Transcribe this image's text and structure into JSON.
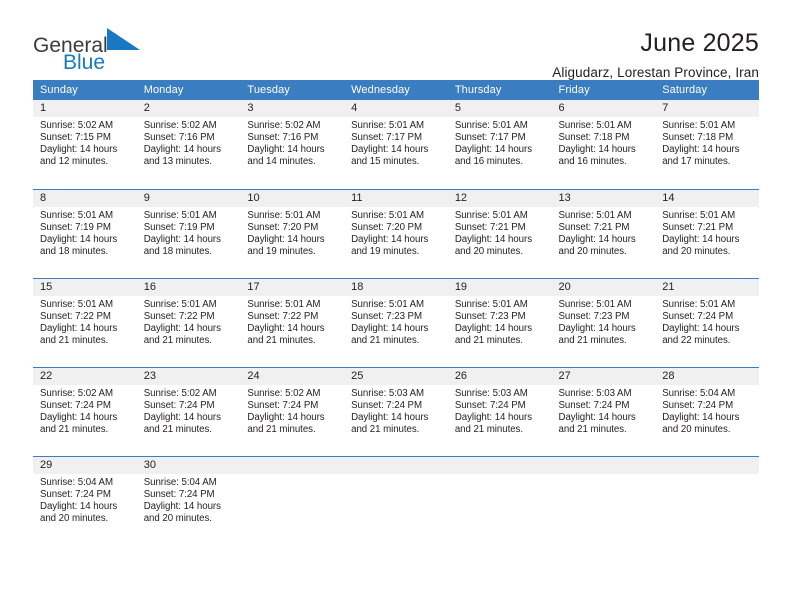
{
  "brand": {
    "word1": "General",
    "word2": "Blue",
    "triangle_color": "#1878c4",
    "word1_color": "#3c3c3c",
    "word2_color": "#1878c4"
  },
  "header": {
    "title": "June 2025",
    "subtitle": "Aligudarz, Lorestan Province, Iran"
  },
  "theme": {
    "header_bg": "#3a7dc0",
    "header_text": "#ffffff",
    "daynum_bg": "#f0f0f0",
    "row_divider": "#3a7dc0",
    "body_text": "#231f20"
  },
  "calendar": {
    "weekday_headers": [
      "Sunday",
      "Monday",
      "Tuesday",
      "Wednesday",
      "Thursday",
      "Friday",
      "Saturday"
    ],
    "weeks": [
      [
        {
          "day": "1",
          "lines": [
            "Sunrise: 5:02 AM",
            "Sunset: 7:15 PM",
            "Daylight: 14 hours",
            "and 12 minutes."
          ]
        },
        {
          "day": "2",
          "lines": [
            "Sunrise: 5:02 AM",
            "Sunset: 7:16 PM",
            "Daylight: 14 hours",
            "and 13 minutes."
          ]
        },
        {
          "day": "3",
          "lines": [
            "Sunrise: 5:02 AM",
            "Sunset: 7:16 PM",
            "Daylight: 14 hours",
            "and 14 minutes."
          ]
        },
        {
          "day": "4",
          "lines": [
            "Sunrise: 5:01 AM",
            "Sunset: 7:17 PM",
            "Daylight: 14 hours",
            "and 15 minutes."
          ]
        },
        {
          "day": "5",
          "lines": [
            "Sunrise: 5:01 AM",
            "Sunset: 7:17 PM",
            "Daylight: 14 hours",
            "and 16 minutes."
          ]
        },
        {
          "day": "6",
          "lines": [
            "Sunrise: 5:01 AM",
            "Sunset: 7:18 PM",
            "Daylight: 14 hours",
            "and 16 minutes."
          ]
        },
        {
          "day": "7",
          "lines": [
            "Sunrise: 5:01 AM",
            "Sunset: 7:18 PM",
            "Daylight: 14 hours",
            "and 17 minutes."
          ]
        }
      ],
      [
        {
          "day": "8",
          "lines": [
            "Sunrise: 5:01 AM",
            "Sunset: 7:19 PM",
            "Daylight: 14 hours",
            "and 18 minutes."
          ]
        },
        {
          "day": "9",
          "lines": [
            "Sunrise: 5:01 AM",
            "Sunset: 7:19 PM",
            "Daylight: 14 hours",
            "and 18 minutes."
          ]
        },
        {
          "day": "10",
          "lines": [
            "Sunrise: 5:01 AM",
            "Sunset: 7:20 PM",
            "Daylight: 14 hours",
            "and 19 minutes."
          ]
        },
        {
          "day": "11",
          "lines": [
            "Sunrise: 5:01 AM",
            "Sunset: 7:20 PM",
            "Daylight: 14 hours",
            "and 19 minutes."
          ]
        },
        {
          "day": "12",
          "lines": [
            "Sunrise: 5:01 AM",
            "Sunset: 7:21 PM",
            "Daylight: 14 hours",
            "and 20 minutes."
          ]
        },
        {
          "day": "13",
          "lines": [
            "Sunrise: 5:01 AM",
            "Sunset: 7:21 PM",
            "Daylight: 14 hours",
            "and 20 minutes."
          ]
        },
        {
          "day": "14",
          "lines": [
            "Sunrise: 5:01 AM",
            "Sunset: 7:21 PM",
            "Daylight: 14 hours",
            "and 20 minutes."
          ]
        }
      ],
      [
        {
          "day": "15",
          "lines": [
            "Sunrise: 5:01 AM",
            "Sunset: 7:22 PM",
            "Daylight: 14 hours",
            "and 21 minutes."
          ]
        },
        {
          "day": "16",
          "lines": [
            "Sunrise: 5:01 AM",
            "Sunset: 7:22 PM",
            "Daylight: 14 hours",
            "and 21 minutes."
          ]
        },
        {
          "day": "17",
          "lines": [
            "Sunrise: 5:01 AM",
            "Sunset: 7:22 PM",
            "Daylight: 14 hours",
            "and 21 minutes."
          ]
        },
        {
          "day": "18",
          "lines": [
            "Sunrise: 5:01 AM",
            "Sunset: 7:23 PM",
            "Daylight: 14 hours",
            "and 21 minutes."
          ]
        },
        {
          "day": "19",
          "lines": [
            "Sunrise: 5:01 AM",
            "Sunset: 7:23 PM",
            "Daylight: 14 hours",
            "and 21 minutes."
          ]
        },
        {
          "day": "20",
          "lines": [
            "Sunrise: 5:01 AM",
            "Sunset: 7:23 PM",
            "Daylight: 14 hours",
            "and 21 minutes."
          ]
        },
        {
          "day": "21",
          "lines": [
            "Sunrise: 5:01 AM",
            "Sunset: 7:24 PM",
            "Daylight: 14 hours",
            "and 22 minutes."
          ]
        }
      ],
      [
        {
          "day": "22",
          "lines": [
            "Sunrise: 5:02 AM",
            "Sunset: 7:24 PM",
            "Daylight: 14 hours",
            "and 21 minutes."
          ]
        },
        {
          "day": "23",
          "lines": [
            "Sunrise: 5:02 AM",
            "Sunset: 7:24 PM",
            "Daylight: 14 hours",
            "and 21 minutes."
          ]
        },
        {
          "day": "24",
          "lines": [
            "Sunrise: 5:02 AM",
            "Sunset: 7:24 PM",
            "Daylight: 14 hours",
            "and 21 minutes."
          ]
        },
        {
          "day": "25",
          "lines": [
            "Sunrise: 5:03 AM",
            "Sunset: 7:24 PM",
            "Daylight: 14 hours",
            "and 21 minutes."
          ]
        },
        {
          "day": "26",
          "lines": [
            "Sunrise: 5:03 AM",
            "Sunset: 7:24 PM",
            "Daylight: 14 hours",
            "and 21 minutes."
          ]
        },
        {
          "day": "27",
          "lines": [
            "Sunrise: 5:03 AM",
            "Sunset: 7:24 PM",
            "Daylight: 14 hours",
            "and 21 minutes."
          ]
        },
        {
          "day": "28",
          "lines": [
            "Sunrise: 5:04 AM",
            "Sunset: 7:24 PM",
            "Daylight: 14 hours",
            "and 20 minutes."
          ]
        }
      ],
      [
        {
          "day": "29",
          "lines": [
            "Sunrise: 5:04 AM",
            "Sunset: 7:24 PM",
            "Daylight: 14 hours",
            "and 20 minutes."
          ]
        },
        {
          "day": "30",
          "lines": [
            "Sunrise: 5:04 AM",
            "Sunset: 7:24 PM",
            "Daylight: 14 hours",
            "and 20 minutes."
          ]
        },
        {
          "day": "",
          "lines": []
        },
        {
          "day": "",
          "lines": []
        },
        {
          "day": "",
          "lines": []
        },
        {
          "day": "",
          "lines": []
        },
        {
          "day": "",
          "lines": []
        }
      ]
    ]
  }
}
